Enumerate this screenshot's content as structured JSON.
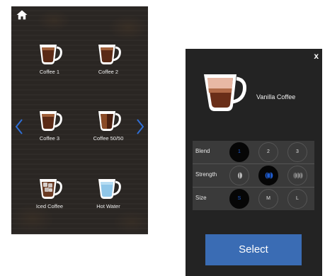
{
  "menu": {
    "items": [
      {
        "label": "Coffee 1",
        "drink": "coffee"
      },
      {
        "label": "Coffee 2",
        "drink": "coffee"
      },
      {
        "label": "Coffee 3",
        "drink": "coffee"
      },
      {
        "label": "Coffee 50/50",
        "drink": "coffee"
      },
      {
        "label": "Iced Coffee",
        "drink": "iced"
      },
      {
        "label": "Hot Water",
        "drink": "water"
      }
    ],
    "accent_color": "#2f6fd6"
  },
  "detail": {
    "close_label": "x",
    "drink_name": "Vanilla Coffee",
    "options": {
      "blend": {
        "label": "Blend",
        "choices": [
          "1",
          "2",
          "3"
        ],
        "selected": "1"
      },
      "strength": {
        "label": "Strength",
        "choices": [
          "mild",
          "medium",
          "strong"
        ],
        "selected": "medium"
      },
      "size": {
        "label": "Size",
        "choices": [
          "S",
          "M",
          "L"
        ],
        "selected": "S"
      }
    },
    "select_label": "Select",
    "select_color": "#3a6cb4",
    "selected_color": "#1f5fd6"
  }
}
